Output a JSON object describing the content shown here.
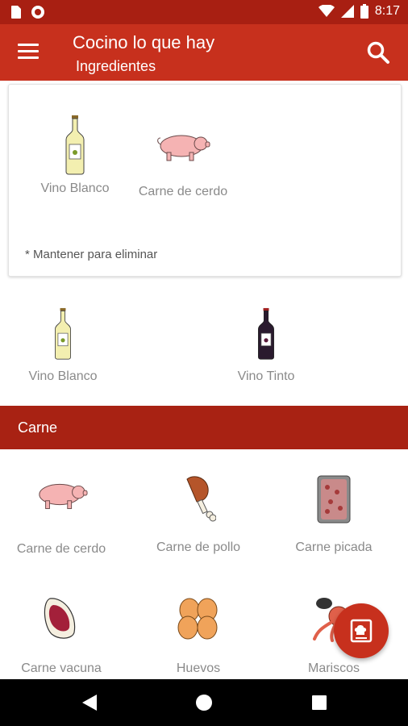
{
  "status_bar": {
    "time": "8:17"
  },
  "app_bar": {
    "title": "Cocino lo que hay",
    "subtitle": "Ingredientes"
  },
  "selected": {
    "items": [
      {
        "label": "Vino Blanco",
        "icon": "white-wine-bottle-icon"
      },
      {
        "label": "Carne de cerdo",
        "icon": "pig-icon"
      }
    ],
    "hint": "* Mantener para eliminar"
  },
  "suggestions": [
    {
      "label": "Vino Blanco",
      "icon": "white-wine-bottle-icon"
    },
    {
      "label": "Vino Tinto",
      "icon": "red-wine-bottle-icon"
    }
  ],
  "category": {
    "title": "Carne",
    "items": [
      {
        "label": "Carne de cerdo",
        "icon": "pig-icon"
      },
      {
        "label": "Carne de pollo",
        "icon": "chicken-leg-icon"
      },
      {
        "label": "Carne picada",
        "icon": "minced-meat-icon"
      },
      {
        "label": "Carne vacuna",
        "icon": "steak-icon"
      },
      {
        "label": "Huevos",
        "icon": "eggs-icon"
      },
      {
        "label": "Mariscos",
        "icon": "seafood-icon"
      }
    ]
  },
  "colors": {
    "app_bar": "#c7301d",
    "status_bar": "#a81f12",
    "category_header": "#a82213",
    "label_gray": "#8a8a8a"
  }
}
